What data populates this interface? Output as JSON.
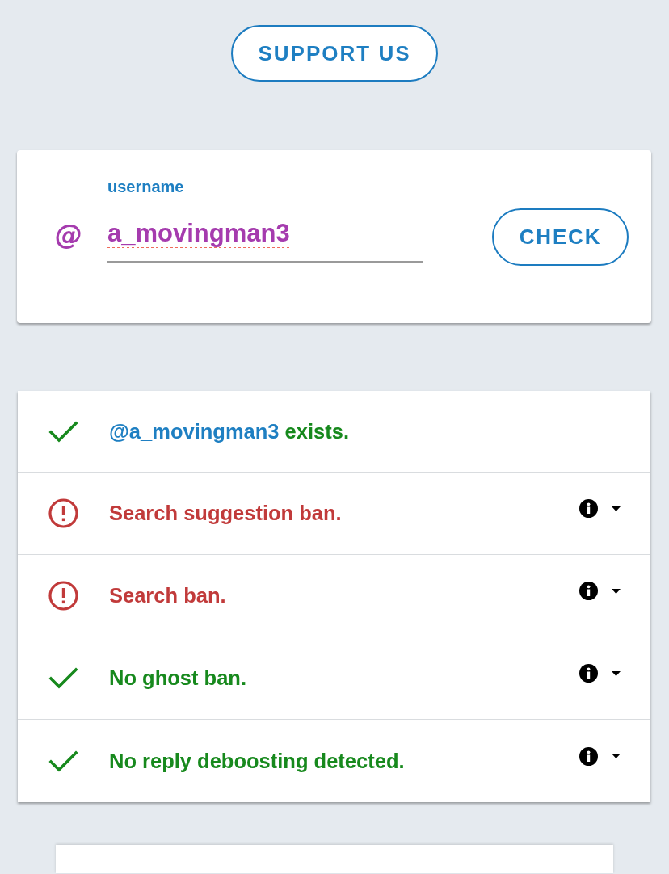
{
  "support_button": {
    "label": "SUPPORT US"
  },
  "lookup": {
    "prefix": "@",
    "field": {
      "label": "username",
      "value": "a_movingman3",
      "spelling_error": true
    },
    "check_button": {
      "label": "CHECK"
    }
  },
  "results": [
    {
      "kind": "passed",
      "user": "@a_movingman3",
      "text": "exists.",
      "details": false
    },
    {
      "kind": "flagged",
      "text": "Search suggestion ban.",
      "details": true
    },
    {
      "kind": "flagged",
      "text": "Search ban.",
      "details": true
    },
    {
      "kind": "passed",
      "text": "No ghost ban.",
      "details": true
    },
    {
      "kind": "passed",
      "text": "No reply deboosting detected.",
      "details": true
    }
  ]
}
